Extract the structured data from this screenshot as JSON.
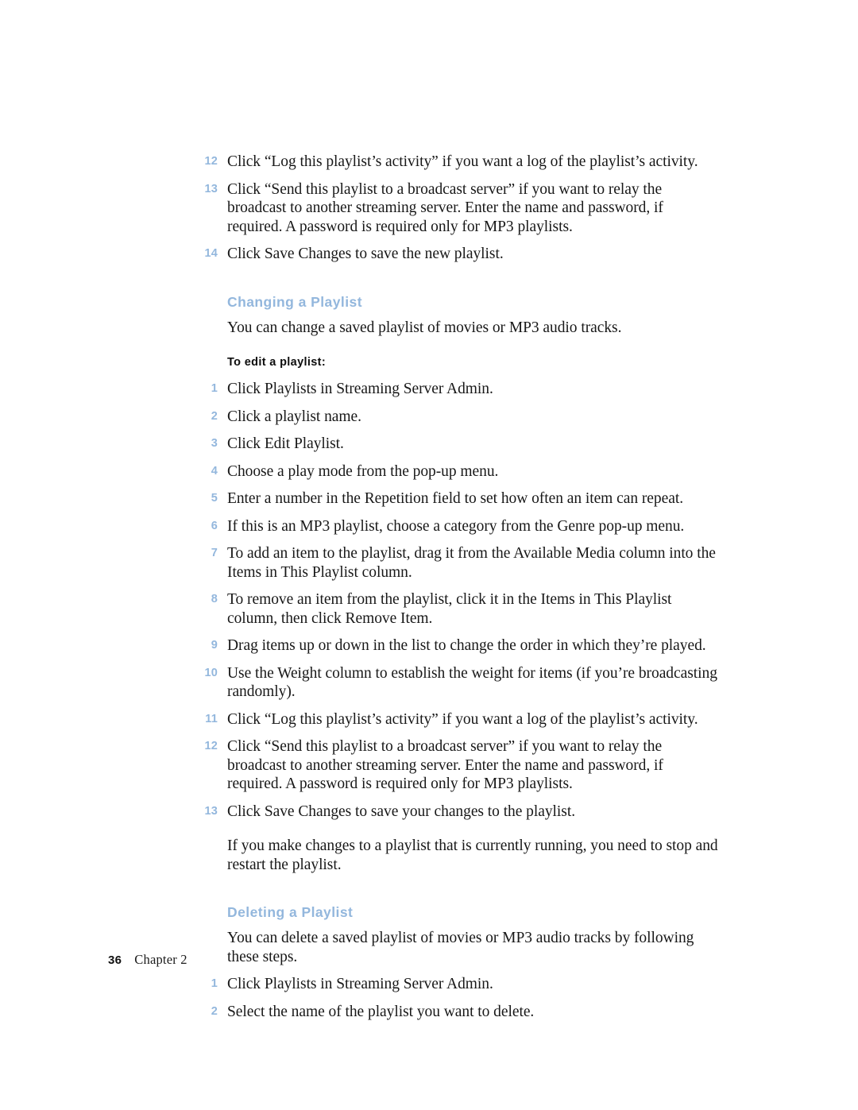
{
  "document": {
    "page_number": "36",
    "chapter_label": "Chapter  2"
  },
  "colors": {
    "accent_blue": "#93b7dd",
    "body_text": "#181818",
    "page_background": "#ffffff"
  },
  "top_steps": [
    {
      "number": "12",
      "text": "Click “Log this playlist’s activity” if you want a log of the playlist’s activity."
    },
    {
      "number": "13",
      "text": "Click “Send this playlist to a broadcast server” if you want to relay the broadcast to another streaming server. Enter the name and password, if required. A password is required only for MP3 playlists."
    },
    {
      "number": "14",
      "text": "Click Save Changes to save the new playlist."
    }
  ],
  "changing_section": {
    "heading": "Changing a Playlist",
    "intro": "You can change a saved playlist of movies or MP3 audio tracks.",
    "sub_heading": "To edit a playlist:",
    "steps": [
      {
        "number": "1",
        "text": "Click Playlists in Streaming Server Admin."
      },
      {
        "number": "2",
        "text": "Click a playlist name."
      },
      {
        "number": "3",
        "text": "Click Edit Playlist."
      },
      {
        "number": "4",
        "text": "Choose a play mode from the pop-up menu."
      },
      {
        "number": "5",
        "text": "Enter a number in the Repetition field to set how often an item can repeat."
      },
      {
        "number": "6",
        "text": "If this is an MP3 playlist, choose a category from the Genre pop-up menu."
      },
      {
        "number": "7",
        "text": "To add an item to the playlist, drag it from the Available Media column into the Items in This Playlist column."
      },
      {
        "number": "8",
        "text": "To remove an item from the playlist, click it in the Items in This Playlist column, then click Remove Item."
      },
      {
        "number": "9",
        "text": "Drag items up or down in the list to change the order in which they’re played."
      },
      {
        "number": "10",
        "text": "Use the Weight column to establish the weight for items (if you’re broadcasting randomly)."
      },
      {
        "number": "11",
        "text": "Click “Log this playlist’s activity” if you want a log of the playlist’s activity."
      },
      {
        "number": "12",
        "text": "Click “Send this playlist to a broadcast server” if you want to relay the broadcast to another streaming server. Enter the name and password, if required. A password is required only for MP3 playlists."
      },
      {
        "number": "13",
        "text": "Click Save Changes to save your changes to the playlist."
      }
    ],
    "closing_note": "If you make changes to a playlist that is currently running, you need to stop and restart the playlist."
  },
  "deleting_section": {
    "heading": "Deleting a Playlist",
    "intro": "You can delete a saved playlist of movies or MP3 audio tracks by following these steps.",
    "steps": [
      {
        "number": "1",
        "text": "Click Playlists in Streaming Server Admin."
      },
      {
        "number": "2",
        "text": "Select the name of the playlist you want to delete."
      }
    ]
  }
}
